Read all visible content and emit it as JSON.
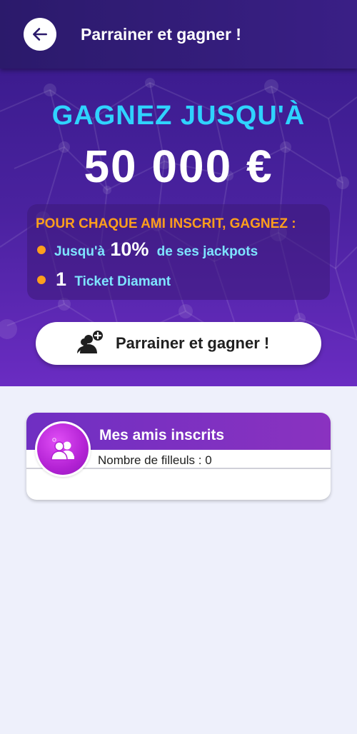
{
  "header": {
    "title": "Parrainer et gagner !",
    "back_icon": "arrow-left-icon"
  },
  "hero": {
    "headline": "GAGNEZ JUSQU'À",
    "amount": "50 000 €",
    "promo_title": "POUR CHAQUE AMI INSCRIT, GAGNEZ :",
    "bullet1_prefix": "Jusqu'à",
    "bullet1_value": "10%",
    "bullet1_suffix": "de ses jackpots",
    "bullet2_value": "1",
    "bullet2_suffix": "Ticket Diamant",
    "cta_label": "Parrainer et gagner !",
    "cta_icon": "add-user-icon"
  },
  "friends_card": {
    "title": "Mes amis inscrits",
    "subtitle": "Nombre de filleuls : 0",
    "icon": "users-icon"
  },
  "colors": {
    "header": "#2b1a6b",
    "hero_top": "#3c1c8f",
    "hero_bottom": "#6a2cc2",
    "headline": "#2fd3ff",
    "accent_orange": "#ff9f1c",
    "bullet_text": "#7ee4ff",
    "card_header": "#7a30c2",
    "background": "#eef0fb"
  }
}
